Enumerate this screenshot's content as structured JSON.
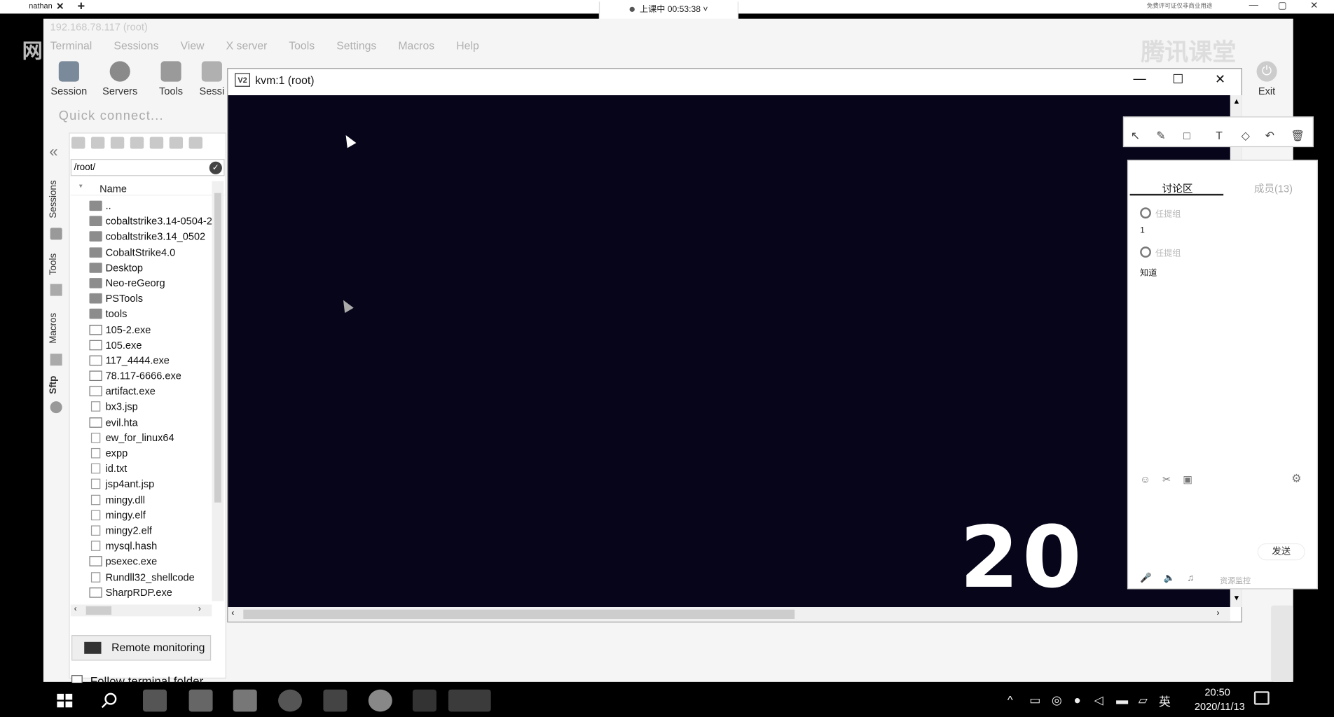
{
  "topbar": {
    "tab_label": "nathan",
    "tab_close": "✕",
    "tab_add": "+",
    "recording": "上课中 00:53:38",
    "recording_caret": "˅",
    "right_note": "免费评可证仅非商业用途",
    "win_min": "—",
    "win_max": "▢",
    "win_close": "✕"
  },
  "corner_text": "网",
  "moba": {
    "title": "192.168.78.117 (root)",
    "menu": [
      "Terminal",
      "Sessions",
      "View",
      "X server",
      "Tools",
      "Settings",
      "Macros",
      "Help"
    ],
    "toolbar": [
      "Session",
      "Servers",
      "Tools",
      "Sessi"
    ],
    "exit_label": "Exit",
    "quick_connect": "Quick connect...",
    "logo_text": "腾讯课堂",
    "side_tabs": [
      "Sessions",
      "Tools",
      "Macros",
      "Sftp"
    ],
    "collapse_glyph": "«"
  },
  "sftp": {
    "path": "/root/",
    "column_header": "Name",
    "files": [
      {
        "name": "..",
        "kind": "folder"
      },
      {
        "name": "cobaltstrike3.14-0504-2",
        "kind": "folder"
      },
      {
        "name": "cobaltstrike3.14_0502",
        "kind": "folder"
      },
      {
        "name": "CobaltStrike4.0",
        "kind": "folder"
      },
      {
        "name": "Desktop",
        "kind": "folder"
      },
      {
        "name": "Neo-reGeorg",
        "kind": "folder"
      },
      {
        "name": "PSTools",
        "kind": "folder"
      },
      {
        "name": "tools",
        "kind": "folder"
      },
      {
        "name": "105-2.exe",
        "kind": "exe"
      },
      {
        "name": "105.exe",
        "kind": "exe"
      },
      {
        "name": "117_4444.exe",
        "kind": "exe"
      },
      {
        "name": "78.117-6666.exe",
        "kind": "exe"
      },
      {
        "name": "artifact.exe",
        "kind": "exe"
      },
      {
        "name": "bx3.jsp",
        "kind": "doc"
      },
      {
        "name": "evil.hta",
        "kind": "exe"
      },
      {
        "name": "ew_for_linux64",
        "kind": "doc"
      },
      {
        "name": "expp",
        "kind": "doc"
      },
      {
        "name": "id.txt",
        "kind": "doc"
      },
      {
        "name": "jsp4ant.jsp",
        "kind": "doc"
      },
      {
        "name": "mingy.dll",
        "kind": "doc"
      },
      {
        "name": "mingy.elf",
        "kind": "doc"
      },
      {
        "name": "mingy2.elf",
        "kind": "doc"
      },
      {
        "name": "mysql.hash",
        "kind": "doc"
      },
      {
        "name": "psexec.exe",
        "kind": "exe"
      },
      {
        "name": "Rundll32_shellcode",
        "kind": "doc"
      },
      {
        "name": "SharpRDP.exe",
        "kind": "exe"
      }
    ],
    "remote_monitoring": "Remote monitoring",
    "follow_terminal": "Follow terminal folder"
  },
  "vnc": {
    "logo": "V2",
    "title": "kvm:1 (root)",
    "minimize": "—",
    "maximize": "☐",
    "close": "✕",
    "clock_text": "20 :"
  },
  "annotation_tools": [
    "pointer-icon",
    "pen-icon",
    "rectangle-icon",
    "text-icon",
    "eraser-icon",
    "undo-icon",
    "trash-icon"
  ],
  "annotation_glyphs": [
    "↖",
    "✎",
    "□",
    "T",
    "◇",
    "↶",
    "🗑"
  ],
  "chat": {
    "tab_discussion": "讨论区",
    "tab_members": "成员(13)",
    "messages": [
      {
        "user": "任提组",
        "text": "1"
      },
      {
        "user": "任提组",
        "text": "知道"
      }
    ],
    "send": "发送",
    "resource_monitor": "资源监控"
  },
  "taskbar": {
    "time": "20:50",
    "date": "2020/11/13",
    "ime": "英"
  },
  "colors": {
    "vnc_screen": "#06051a",
    "taskbar": "#000000"
  }
}
